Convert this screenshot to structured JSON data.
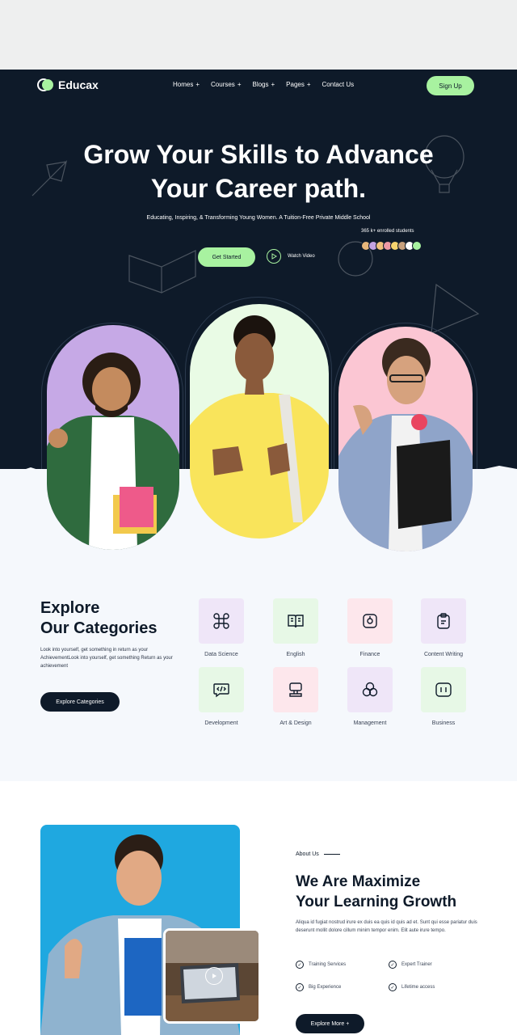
{
  "nav": {
    "logo_text": "Educax",
    "items": [
      {
        "label": "Homes",
        "suffix": "+"
      },
      {
        "label": "Courses",
        "suffix": "+"
      },
      {
        "label": "Blogs",
        "suffix": "+"
      },
      {
        "label": "Pages",
        "suffix": "+"
      },
      {
        "label": "Contact Us",
        "suffix": ""
      }
    ],
    "signup_label": "Sign Up"
  },
  "hero": {
    "title_line1": "Grow Your Skills to Advance",
    "title_line2": "Your Career path.",
    "subtitle": "Educating, Inspiring, & Transforming Young Women. A Tuition-Free Private Middle School",
    "enrolled_text": "365 k+ enrolled students",
    "get_started_label": "Get Started",
    "watch_label": "Watch Video"
  },
  "categories": {
    "title_line1": "Explore",
    "title_line2": "Our Categories",
    "description": "Look into yourself, get something in return as your AchievementLook into yourself, get something Return as your achievement",
    "button_label": "Explore Categories",
    "items": [
      {
        "label": "Data Science",
        "icon": "command-icon",
        "color": "#efe6f8"
      },
      {
        "label": "English",
        "icon": "book-icon",
        "color": "#e7f8e6"
      },
      {
        "label": "Finance",
        "icon": "safe-icon",
        "color": "#fde7ec"
      },
      {
        "label": "Content Writing",
        "icon": "clipboard-icon",
        "color": "#efe6f8"
      },
      {
        "label": "Development",
        "icon": "code-icon",
        "color": "#e7f8e6"
      },
      {
        "label": "Art & Design",
        "icon": "stamp-icon",
        "color": "#fde7ec"
      },
      {
        "label": "Management",
        "icon": "circles-icon",
        "color": "#efe6f8"
      },
      {
        "label": "Business",
        "icon": "chart-box-icon",
        "color": "#e7f8e6"
      }
    ]
  },
  "about": {
    "tag": "About Us",
    "title_line1": "We Are Maximize",
    "title_line2": "Your Learning Growth",
    "description": "Aliqua id fugiat nostrud irure ex duis ea quis id quis ad et. Sunt qui esse pariatur duis deserunt mollit dolore cillum minim tempor enim. Elit aute irure tempo.",
    "features": [
      "Training Services",
      "Expert Trainer",
      "Big Experience",
      "Lifetime access"
    ],
    "button_label": "Explore More +"
  },
  "colors": {
    "navy": "#0e1a29",
    "accent_green": "#a8f2a0",
    "lavender": "#c6a9e6",
    "mint": "#e9fbe5",
    "pink": "#fbc6d3"
  }
}
